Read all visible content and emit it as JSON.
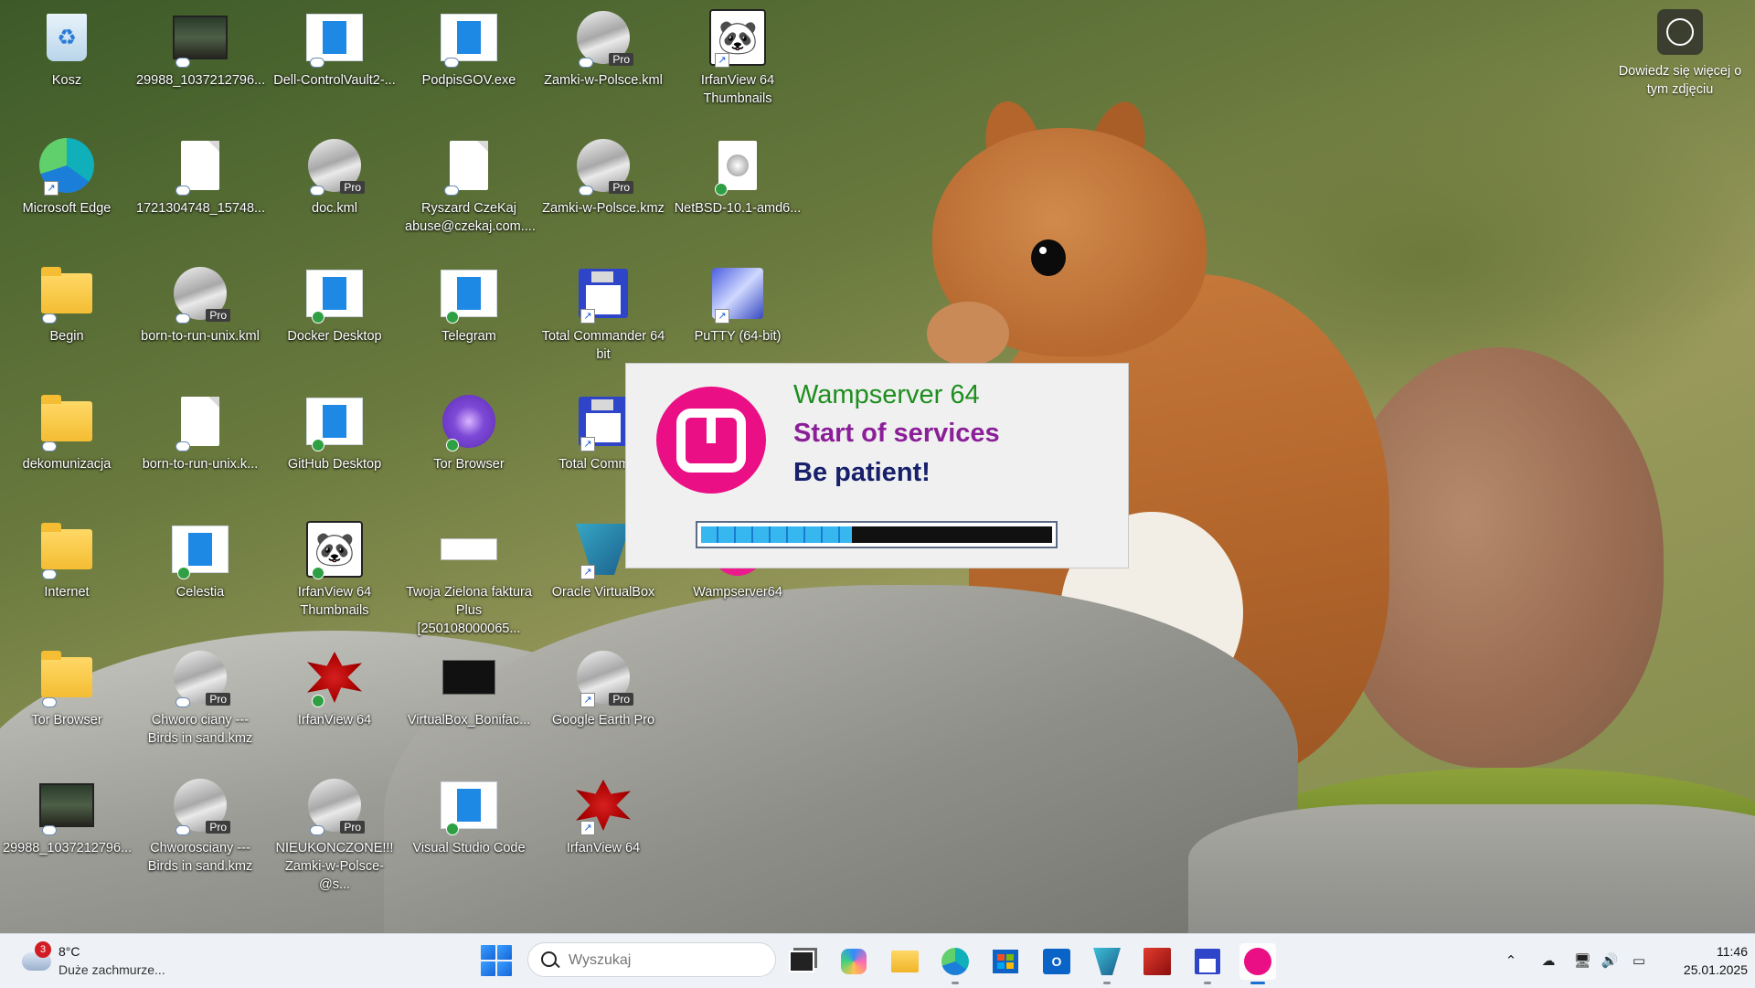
{
  "desktop_icons": [
    {
      "label": "Kosz",
      "icon": "recycle-bin-icon"
    },
    {
      "label": "29988_1037212796...",
      "icon": "photo-icon"
    },
    {
      "label": "Dell-ControlVault2-...",
      "icon": "exe-icon"
    },
    {
      "label": "PodpisGOV.exe",
      "icon": "exe-icon"
    },
    {
      "label": "Zamki-w-Polsce.kml",
      "icon": "google-earth-icon"
    },
    {
      "label": "IrfanView 64 Thumbnails",
      "icon": "irfanview-thumbnails-icon"
    },
    {
      "label": "Microsoft Edge",
      "icon": "edge-icon"
    },
    {
      "label": "1721304748_15748...",
      "icon": "document-icon"
    },
    {
      "label": "doc.kml",
      "icon": "google-earth-icon"
    },
    {
      "label": "Ryszard CzeKaj abuse@czekaj.com....",
      "icon": "document-icon"
    },
    {
      "label": "Zamki-w-Polsce.kmz",
      "icon": "google-earth-icon"
    },
    {
      "label": "NetBSD-10.1-amd6...",
      "icon": "disc-image-icon"
    },
    {
      "label": "Begin",
      "icon": "folder-icon"
    },
    {
      "label": "born-to-run-unix.kml",
      "icon": "google-earth-icon"
    },
    {
      "label": "Docker Desktop",
      "icon": "exe-icon"
    },
    {
      "label": "Telegram",
      "icon": "exe-icon"
    },
    {
      "label": "Total Commander 64 bit",
      "icon": "total-commander-icon"
    },
    {
      "label": "PuTTY (64-bit)",
      "icon": "putty-icon"
    },
    {
      "label": "dekomunizacja",
      "icon": "folder-icon"
    },
    {
      "label": "born-to-run-unix.k...",
      "icon": "document-icon"
    },
    {
      "label": "GitHub Desktop",
      "icon": "exe-icon"
    },
    {
      "label": "Tor Browser",
      "icon": "tor-browser-icon"
    },
    {
      "label": "Total Comma...",
      "icon": "total-commander-icon"
    },
    {
      "label": "Internet",
      "icon": "folder-icon"
    },
    {
      "label": "Celestia",
      "icon": "exe-icon"
    },
    {
      "label": "IrfanView 64 Thumbnails",
      "icon": "irfanview-thumbnails-icon"
    },
    {
      "label": "Twoja Zielona faktura Plus [250108000065...",
      "icon": "receipt-icon"
    },
    {
      "label": "Oracle VirtualBox",
      "icon": "virtualbox-icon"
    },
    {
      "label": "Wampserver64",
      "icon": "wampserver-icon"
    },
    {
      "label": "Tor Browser",
      "icon": "folder-icon"
    },
    {
      "label": "Chworo ciany --- Birds in sand.kmz",
      "icon": "google-earth-icon"
    },
    {
      "label": "IrfanView 64",
      "icon": "irfanview-icon"
    },
    {
      "label": "VirtualBox_Bonifac...",
      "icon": "terminal-screenshot-icon"
    },
    {
      "label": "Google Earth Pro",
      "icon": "google-earth-icon"
    },
    {
      "label": "29988_1037212796...",
      "icon": "photo-icon"
    },
    {
      "label": "Chworosciany --- Birds in sand.kmz",
      "icon": "google-earth-icon"
    },
    {
      "label": "NIEUKONCZONE!!! Zamki-w-Polsce-@s...",
      "icon": "google-earth-icon"
    },
    {
      "label": "Visual Studio Code",
      "icon": "exe-icon"
    },
    {
      "label": "IrfanView 64",
      "icon": "irfanview-icon"
    }
  ],
  "learn_more": {
    "label": "Dowiedz się więcej o tym zdjęciu"
  },
  "splash": {
    "title": "Wampserver 64",
    "line2": "Start of services",
    "line3": "Be patient!",
    "progress": 0.43,
    "colors": {
      "title": "#1e8e1e",
      "line2": "#8a1f98",
      "line3": "#16206b",
      "logo": "#ea0f85"
    }
  },
  "taskbar": {
    "weather": {
      "badge": "3",
      "temp": "8°C",
      "condition": "Duże zachmurze..."
    },
    "search": {
      "placeholder": "Wyszukaj"
    },
    "apps": [
      "task-view",
      "copilot",
      "file-explorer",
      "edge",
      "microsoft-store",
      "outlook",
      "virtualbox",
      "total-commander-x64",
      "total-commander",
      "wampserver"
    ],
    "active_app": "wampserver",
    "clock": {
      "time": "11:46",
      "date": "25.01.2025"
    }
  }
}
